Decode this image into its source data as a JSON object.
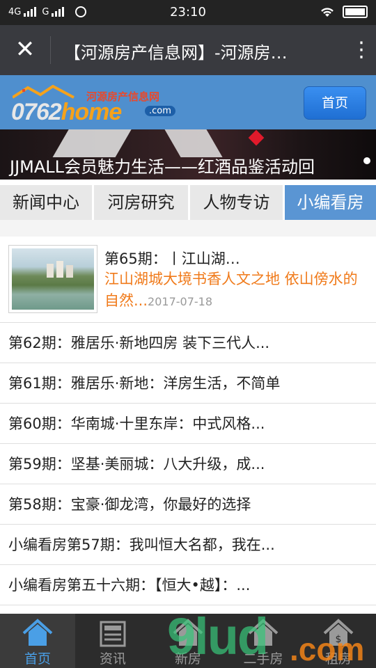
{
  "status_bar": {
    "network_1": "4G",
    "network_2": "G",
    "time": "23:10"
  },
  "title_bar": {
    "title": "【河源房产信息网】-河源房…"
  },
  "site_header": {
    "logo_cn": "河源房产信息网",
    "logo_num": "0762",
    "logo_home": "home",
    "logo_com": ".com",
    "home_button": "首页"
  },
  "banner": {
    "caption": "JJMALL会员魅力生活——红酒品鉴活动回"
  },
  "tabs": [
    {
      "label": "新闻中心",
      "active": false
    },
    {
      "label": "河房研究",
      "active": false
    },
    {
      "label": "人物专访",
      "active": false
    },
    {
      "label": "小编看房",
      "active": true
    }
  ],
  "featured": {
    "title": "第65期：丨江山湖…",
    "description": "江山湖城大境书香人文之地 依山傍水的自然...",
    "date": "2017-07-18"
  },
  "articles": [
    "第62期：雅居乐·新地四房 装下三代人...",
    "第61期：雅居乐·新地：洋房生活，不简单",
    "第60期：华南城·十里东岸：中式风格...",
    "第59期：坚基·美丽城：八大升级，成...",
    "第58期：宝豪·御龙湾，你最好的选择",
    "小编看房第57期：我叫恒大名都，我在...",
    "小编看房第五十六期：【恒大•越】：..."
  ],
  "bottom_nav": [
    {
      "label": "首页",
      "icon": "house-icon",
      "active": true
    },
    {
      "label": "资讯",
      "icon": "newspaper-icon",
      "active": false
    },
    {
      "label": "新房",
      "icon": "new-house-icon",
      "active": false
    },
    {
      "label": "二手房",
      "icon": "second-hand-house-icon",
      "active": false
    },
    {
      "label": "租房",
      "icon": "rent-house-icon",
      "active": false
    }
  ],
  "watermark": {
    "text": "9lud",
    "suffix": ".com"
  },
  "colors": {
    "accent": "#5a95d3",
    "featured_desc": "#f07a1a",
    "nav_active": "#4a9fe6"
  }
}
